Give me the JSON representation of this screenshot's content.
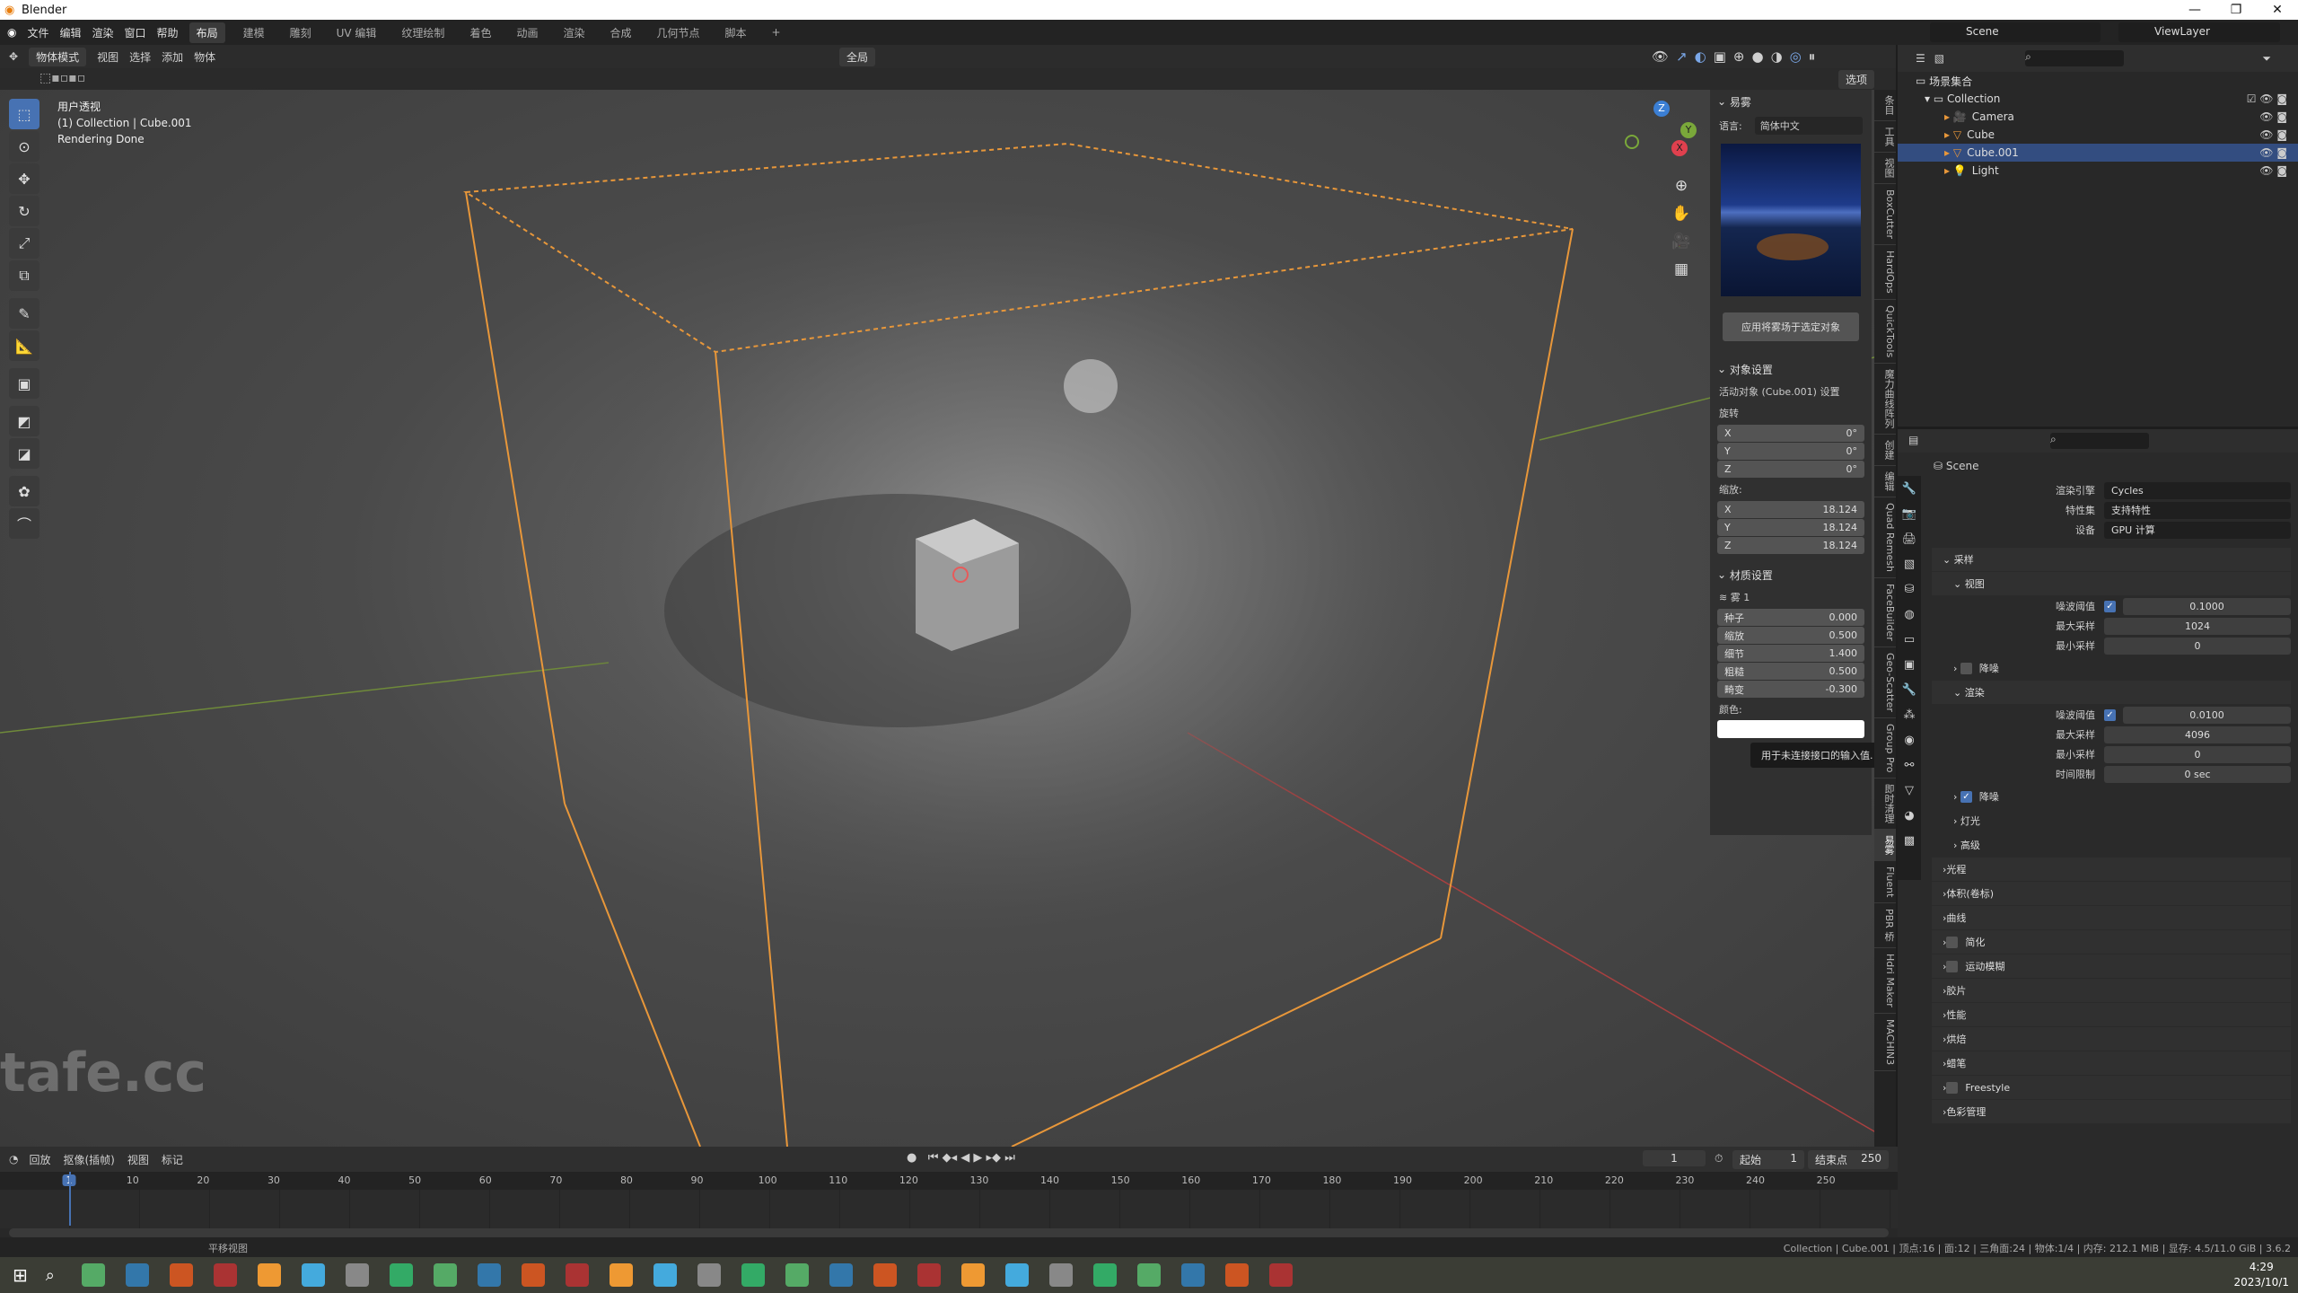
{
  "window": {
    "title": "Blender",
    "min": "—",
    "max": "❐",
    "close": "✕"
  },
  "menu": [
    "文件",
    "编辑",
    "渲染",
    "窗口",
    "帮助"
  ],
  "workspaces": [
    {
      "label": "布局",
      "active": true
    },
    {
      "label": "建模"
    },
    {
      "label": "雕刻"
    },
    {
      "label": "UV 编辑"
    },
    {
      "label": "纹理绘制"
    },
    {
      "label": "着色"
    },
    {
      "label": "动画"
    },
    {
      "label": "渲染"
    },
    {
      "label": "合成"
    },
    {
      "label": "几何节点"
    },
    {
      "label": "脚本"
    },
    {
      "label": "+"
    }
  ],
  "viewport_header": {
    "mode": "物体模式",
    "items": [
      "视图",
      "选择",
      "添加",
      "物体"
    ],
    "transform_orientation": "全局",
    "options": "选项"
  },
  "viewport_info": {
    "view": "用户透视",
    "collection": "(1) Collection | Cube.001",
    "status": "Rendering Done"
  },
  "gizmo": {
    "z": "Z",
    "y": "Y",
    "x": "X"
  },
  "npanel": {
    "title": "易雾",
    "language_label": "语言:",
    "language": "简体中文",
    "apply_button": "应用将雾场于选定对象",
    "object_settings": "对象设置",
    "active_object": "活动对象 (Cube.001) 设置",
    "rotation_label": "旋转",
    "rotation": [
      [
        "X",
        "0°"
      ],
      [
        "Y",
        "0°"
      ],
      [
        "Z",
        "0°"
      ]
    ],
    "scale_label": "缩放:",
    "scale": [
      [
        "X",
        "18.124"
      ],
      [
        "Y",
        "18.124"
      ],
      [
        "Z",
        "18.124"
      ]
    ],
    "material_settings": "材质设置",
    "fog_name": "雾 1",
    "fields": [
      [
        "种子",
        "0.000"
      ],
      [
        "缩放",
        "0.500"
      ],
      [
        "细节",
        "1.400"
      ],
      [
        "粗糙",
        "0.500"
      ],
      [
        "畸变",
        "-0.300"
      ]
    ],
    "tooltip": "用于未连接接口的输入值.",
    "color_label": "颜色:"
  },
  "vtabs": [
    "条目",
    "工具",
    "视图",
    "BoxCutter",
    "HardOps",
    "QuickTools",
    "魔力曲线阵列",
    "创建",
    "编辑",
    "Quad Remesh",
    "FaceBuilder",
    "Geo-Scatter",
    "Group Pro",
    "即时清理",
    "易雾",
    "Fluent",
    "PBR 桥",
    "Hdri Maker",
    "MACHIN3"
  ],
  "vtab_active": "易雾",
  "topbar_right": {
    "scene": "Scene",
    "viewlayer": "ViewLayer"
  },
  "outliner": {
    "root": "场景集合",
    "collection": "Collection",
    "items": [
      {
        "name": "Camera",
        "icon": "camera-icon"
      },
      {
        "name": "Cube",
        "icon": "mesh-icon"
      },
      {
        "name": "Cube.001",
        "icon": "mesh-icon",
        "selected": true
      },
      {
        "name": "Light",
        "icon": "light-icon"
      }
    ]
  },
  "properties": {
    "scene": "Scene",
    "engine_label": "渲染引擎",
    "engine": "Cycles",
    "feature_label": "特性集",
    "feature": "支持特性",
    "device_label": "设备",
    "device": "GPU 计算",
    "sampling": "采样",
    "viewport": "视图",
    "viewport_rows": [
      [
        "噪波阈值",
        "0.1000",
        true
      ],
      [
        "最大采样",
        "1024"
      ],
      [
        "最小采样",
        "0"
      ]
    ],
    "viewport_denoise": "降噪",
    "render": "渲染",
    "render_rows": [
      [
        "噪波阈值",
        "0.0100",
        true
      ],
      [
        "最大采样",
        "4096"
      ],
      [
        "最小采样",
        "0"
      ],
      [
        "时间限制",
        "0 sec"
      ]
    ],
    "render_denoise": "降噪",
    "lights": "灯光",
    "advanced": "高级",
    "sections": [
      {
        "label": "光程"
      },
      {
        "label": "体积(卷标)"
      },
      {
        "label": "曲线"
      },
      {
        "label": "简化",
        "check": true
      },
      {
        "label": "运动模糊",
        "check": true
      },
      {
        "label": "胶片"
      },
      {
        "label": "性能"
      },
      {
        "label": "烘焙"
      },
      {
        "label": "蜡笔"
      },
      {
        "label": "Freestyle",
        "check": true
      },
      {
        "label": "色彩管理"
      }
    ]
  },
  "timeline": {
    "menus": [
      "回放",
      "抠像(插帧)",
      "视图",
      "标记"
    ],
    "current_frame": "1",
    "start_label": "起始",
    "start": "1",
    "end_label": "结束点",
    "end": "250",
    "ticks": [
      1,
      10,
      20,
      30,
      40,
      50,
      60,
      70,
      80,
      90,
      100,
      110,
      120,
      130,
      140,
      150,
      160,
      170,
      180,
      190,
      200,
      210,
      220,
      230,
      240,
      250
    ]
  },
  "statusbar": {
    "left": "平移视图",
    "right": "Collection | Cube.001 | 顶点:16 | 面:12 | 三角面:24 | 物体:1/4 | 内存: 212.1 MiB | 显存: 4.5/11.0 GiB | 3.6.2"
  },
  "taskbar": {
    "time": "4:29",
    "date": "2023/10/1"
  },
  "watermark": "tafe.cc",
  "colors": {
    "accent": "#4772b3",
    "selection_outline": "#e8973a",
    "axis_x": "#c44a4a",
    "axis_y": "#7b9a3a"
  }
}
